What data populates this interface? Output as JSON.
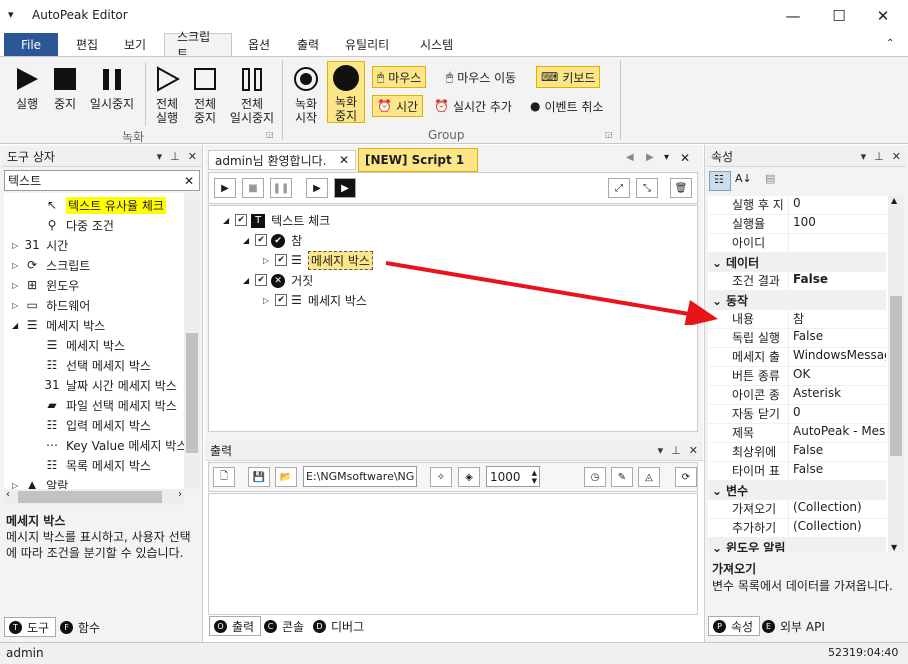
{
  "app": {
    "title": "AutoPeak Editor",
    "minimize": "—",
    "maximize": "☐",
    "close": "✕"
  },
  "menu_tabs": [
    "File",
    "편집",
    "보기",
    "스크립트",
    "옵션",
    "출력",
    "유틸리티",
    "시스템"
  ],
  "ribbon": {
    "run": "실행",
    "stop": "중지",
    "pause": "일시중지",
    "full_run": [
      "전체",
      "실행"
    ],
    "full_stop": [
      "전체",
      "중지"
    ],
    "full_pause": [
      "전체",
      "일시중지"
    ],
    "rec_start": [
      "녹화",
      "시작"
    ],
    "rec_stop": [
      "녹화",
      "중지"
    ],
    "group_record": "녹화",
    "group_group": "Group",
    "mouse": "마우스",
    "mouse_move": "마우스 이동",
    "keyboard": "키보드",
    "time": "시간",
    "realtime_add": "실시간 추가",
    "event_cancel": "이벤트 취소"
  },
  "toolbox": {
    "title": "도구 상자",
    "search": "텍스트",
    "items": [
      {
        "label": "텍스트 유사율 체크",
        "level": 2,
        "icon": "↖"
      },
      {
        "label": "다중 조건",
        "level": 2,
        "icon": "⚲"
      },
      {
        "label": "시간",
        "level": 1,
        "icon": "31"
      },
      {
        "label": "스크립트",
        "level": 1,
        "icon": "⟳"
      },
      {
        "label": "윈도우",
        "level": 1,
        "icon": "⊞"
      },
      {
        "label": "하드웨어",
        "level": 1,
        "icon": "▭"
      },
      {
        "label": "메세지 박스",
        "level": 1,
        "icon": "☰"
      },
      {
        "label": "메세지 박스",
        "level": 2,
        "icon": "☰"
      },
      {
        "label": "선택 메세지 박스",
        "level": 2,
        "icon": "☷"
      },
      {
        "label": "날짜 시간 메세지 박스",
        "level": 2,
        "icon": "31"
      },
      {
        "label": "파일 선택 메세지 박스",
        "level": 2,
        "icon": "▰"
      },
      {
        "label": "입력 메세지 박스",
        "level": 2,
        "icon": "☷"
      },
      {
        "label": "Key Value 메세지 박스",
        "level": 2,
        "icon": "⋯"
      },
      {
        "label": "목록 메세지 박스",
        "level": 2,
        "icon": "☷"
      },
      {
        "label": "알람",
        "level": 1,
        "icon": "▲"
      }
    ],
    "desc_title": "메세지 박스",
    "desc_text": "메시지 박스를 표시하고, 사용자 선택에 따라 조건을 분기할 수 있습니다.",
    "tab_tools": "도구",
    "tab_funcs": "함수"
  },
  "doc_tabs": {
    "welcome": "admin님 환영합니다.",
    "script": "[NEW] Script 1"
  },
  "script_tree": [
    {
      "label": "텍스트 체크",
      "level": 0
    },
    {
      "label": "참",
      "level": 1
    },
    {
      "label": "메세지 박스",
      "level": 2
    },
    {
      "label": "거짓",
      "level": 1
    },
    {
      "label": "메세지 박스",
      "level": 2
    }
  ],
  "output": {
    "title": "출력",
    "path": "E:\\NGMsoftware\\NG",
    "count": "1000",
    "tab_output": "출력",
    "tab_console": "콘솔",
    "tab_debug": "디버그"
  },
  "props": {
    "title": "속성",
    "rows_top": [
      [
        "실행 후 지",
        "0"
      ],
      [
        "실행율",
        "100"
      ],
      [
        "아이디",
        ""
      ]
    ],
    "cat_data": "데이터",
    "rows_data": [
      [
        "조건 결과",
        "False"
      ]
    ],
    "cat_action": "동작",
    "rows_action": [
      [
        "내용",
        "참"
      ],
      [
        "독립 실행",
        "False"
      ],
      [
        "메세지 출",
        "WindowsMessage"
      ],
      [
        "버튼 종류",
        "OK"
      ],
      [
        "아이콘 종",
        "Asterisk"
      ],
      [
        "자동 닫기",
        "0"
      ],
      [
        "제목",
        "AutoPeak - Messa"
      ],
      [
        "최상위에",
        "False"
      ],
      [
        "타이머 표",
        "False"
      ]
    ],
    "cat_var": "변수",
    "rows_var": [
      [
        "가져오기",
        "(Collection)"
      ],
      [
        "추가하기",
        "(Collection)"
      ]
    ],
    "cat_win": "윈도우 알림",
    "desc_title": "가져오기",
    "desc_text": "변수 목록에서 데이터를 가져옵니다.",
    "tab_props": "속성",
    "tab_api": "외부 API"
  },
  "status": {
    "user": "admin",
    "time": "52319:04:40"
  },
  "colors": {
    "accent": "#2b5797",
    "highlight": "#fde68a",
    "arrow": "#e8141c"
  }
}
